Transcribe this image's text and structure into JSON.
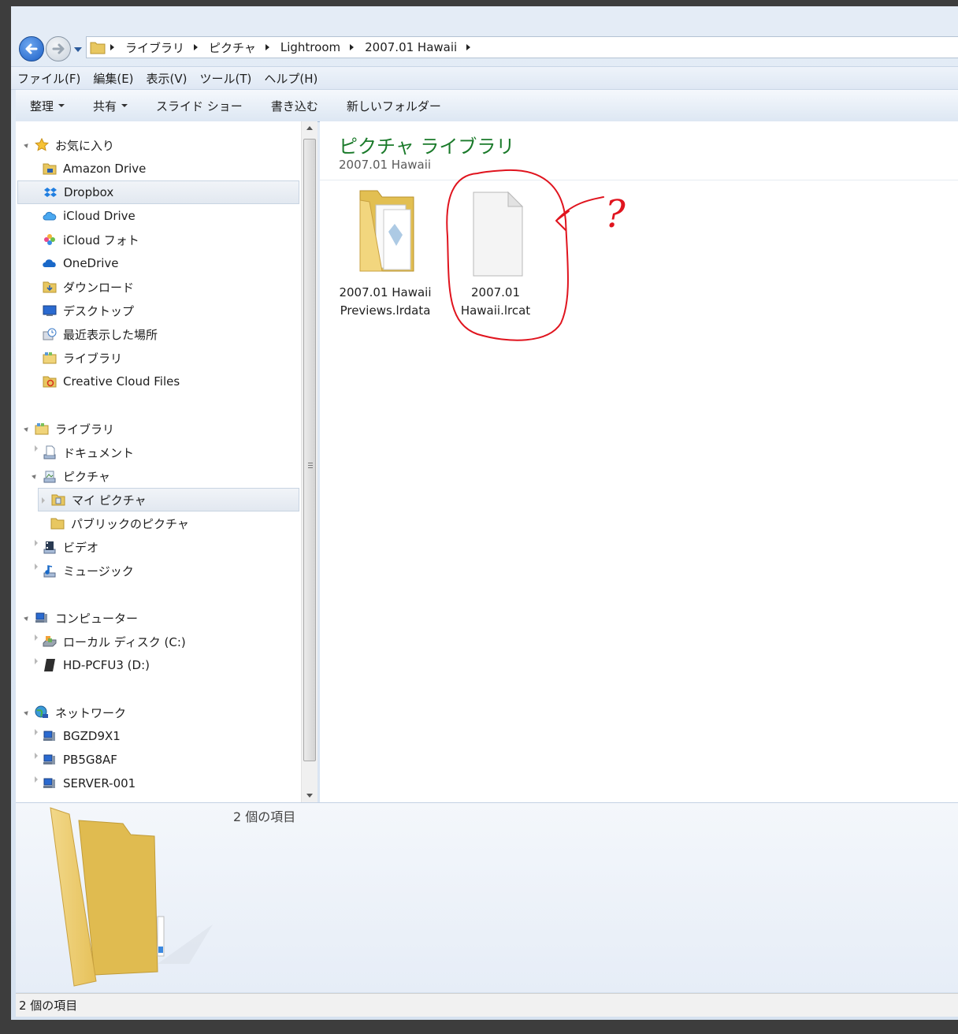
{
  "breadcrumb": [
    "ライブラリ",
    "ピクチャ",
    "Lightroom",
    "2007.01 Hawaii"
  ],
  "menu": [
    "ファイル(F)",
    "編集(E)",
    "表示(V)",
    "ツール(T)",
    "ヘルプ(H)"
  ],
  "toolbar": {
    "organize": "整理",
    "share": "共有",
    "slideshow": "スライド ショー",
    "burn": "書き込む",
    "new_folder": "新しいフォルダー"
  },
  "nav": {
    "favorites": {
      "header": "お気に入り",
      "items": [
        "Amazon Drive",
        "Dropbox",
        "iCloud Drive",
        "iCloud フォト",
        "OneDrive",
        "ダウンロード",
        "デスクトップ",
        "最近表示した場所",
        "ライブラリ",
        "Creative Cloud Files"
      ]
    },
    "libraries": {
      "header": "ライブラリ",
      "documents": "ドキュメント",
      "pictures": "ピクチャ",
      "my_pictures": "マイ ピクチャ",
      "public_pictures": "パブリックのピクチャ",
      "videos": "ビデオ",
      "music": "ミュージック"
    },
    "computer": {
      "header": "コンピューター",
      "items": [
        "ローカル ディスク (C:)",
        "HD-PCFU3 (D:)"
      ]
    },
    "network": {
      "header": "ネットワーク",
      "items": [
        "BGZD9X1",
        "PB5G8AF",
        "SERVER-001"
      ]
    }
  },
  "content": {
    "title": "ピクチャ ライブラリ",
    "subtitle": "2007.01 Hawaii",
    "files": [
      {
        "line1": "2007.01 Hawaii",
        "line2": "Previews.lrdata",
        "icon": "folder-icon"
      },
      {
        "line1": "2007.01",
        "line2": "Hawaii.lrcat",
        "icon": "blank-file-icon"
      }
    ],
    "annotation": "?"
  },
  "details": {
    "count": "2 個の項目"
  },
  "status": {
    "text": "2 個の項目"
  },
  "colors": {
    "accent_title": "#1a7a2a",
    "annotation": "#e0141e",
    "selection": "#e2e8f0"
  }
}
